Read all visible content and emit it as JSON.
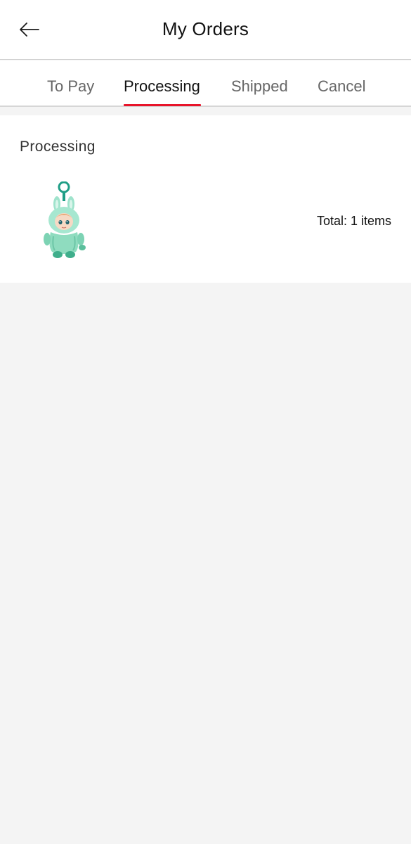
{
  "header": {
    "title": "My Orders",
    "back_icon": "arrow-left-icon"
  },
  "tabs": [
    {
      "label": "To Pay",
      "active": false
    },
    {
      "label": "Processing",
      "active": true
    },
    {
      "label": "Shipped",
      "active": false
    },
    {
      "label": "Cancel",
      "active": false
    }
  ],
  "colors": {
    "accent": "#e8142a",
    "background": "#f4f4f4"
  },
  "orders": [
    {
      "status": "Processing",
      "thumbnail_icon": "plush-keychain-image",
      "total": "Total: 1 items"
    }
  ]
}
